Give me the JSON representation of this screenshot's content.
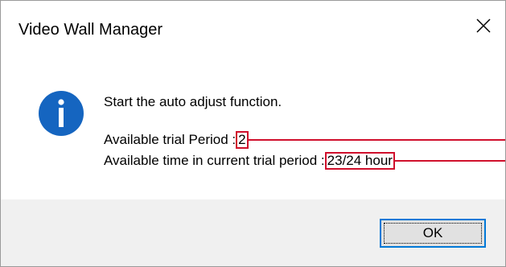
{
  "window": {
    "title": "Video Wall Manager",
    "close_icon": "close-icon"
  },
  "message": {
    "icon": "info-icon",
    "line1": "Start the auto adjust function.",
    "line2_label": "Available trial Period :",
    "line2_value": "2",
    "line3_label": "Available time in current trial period :",
    "line3_value": "23/24 hour"
  },
  "buttons": {
    "ok_label": "OK"
  },
  "colors": {
    "highlight": "#d0102c",
    "info_icon": "#1565c0",
    "button_focus": "#0078d7"
  }
}
